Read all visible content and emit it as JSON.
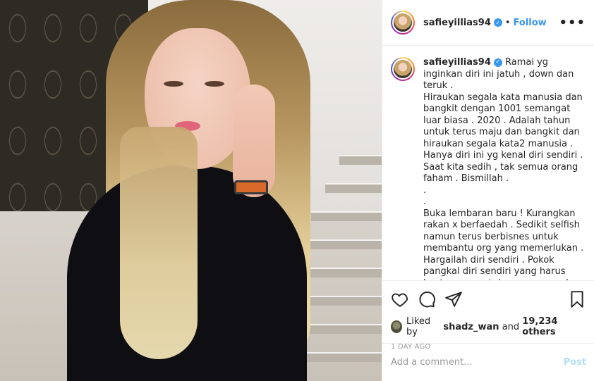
{
  "post": {
    "username": "safieyillias94",
    "follow_label": "Follow",
    "separator": "•",
    "more_label": "•••",
    "photo_alt": ""
  },
  "caption": {
    "username": "safieyillias94",
    "text": "Ramai yg inginkan diri ini jatuh , down dan teruk .\nHiraukan segala kata manusia dan bangkit dengan 1001 semangat luar biasa . 2020 . Adalah tahun untuk terus maju dan bangkit dan hiraukan segala kata2 manusia .\nHanya diri ini yg kenal diri sendiri .\nSaat kita sedih , tak semua orang faham . Bismillah .\n.\n.\nBuka lembaran baru ! Kurangkan rakan x berfaedah . Sedikit selfish namun terus berbisnes untuk membantu org yang memerlukan .\nHargailah diri sendiri . Pokok pangkal diri sendiri yang harus kuat semangat dan sayang pada diri sendiri . Walau ramai"
  },
  "actions": {
    "icons": [
      "heart-icon",
      "comment-icon",
      "share-icon",
      "bookmark-icon"
    ]
  },
  "likes": {
    "prefix": "Liked by",
    "user": "shadz_wan",
    "joiner": "and",
    "others": "19,234 others"
  },
  "timestamp": "1 DAY AGO",
  "comment": {
    "placeholder": "Add a comment...",
    "value": "",
    "post_label": "Post"
  },
  "colors": {
    "accent": "#3897f0",
    "post_disabled": "#b2dffc",
    "muted": "#999999",
    "text": "#262626"
  }
}
